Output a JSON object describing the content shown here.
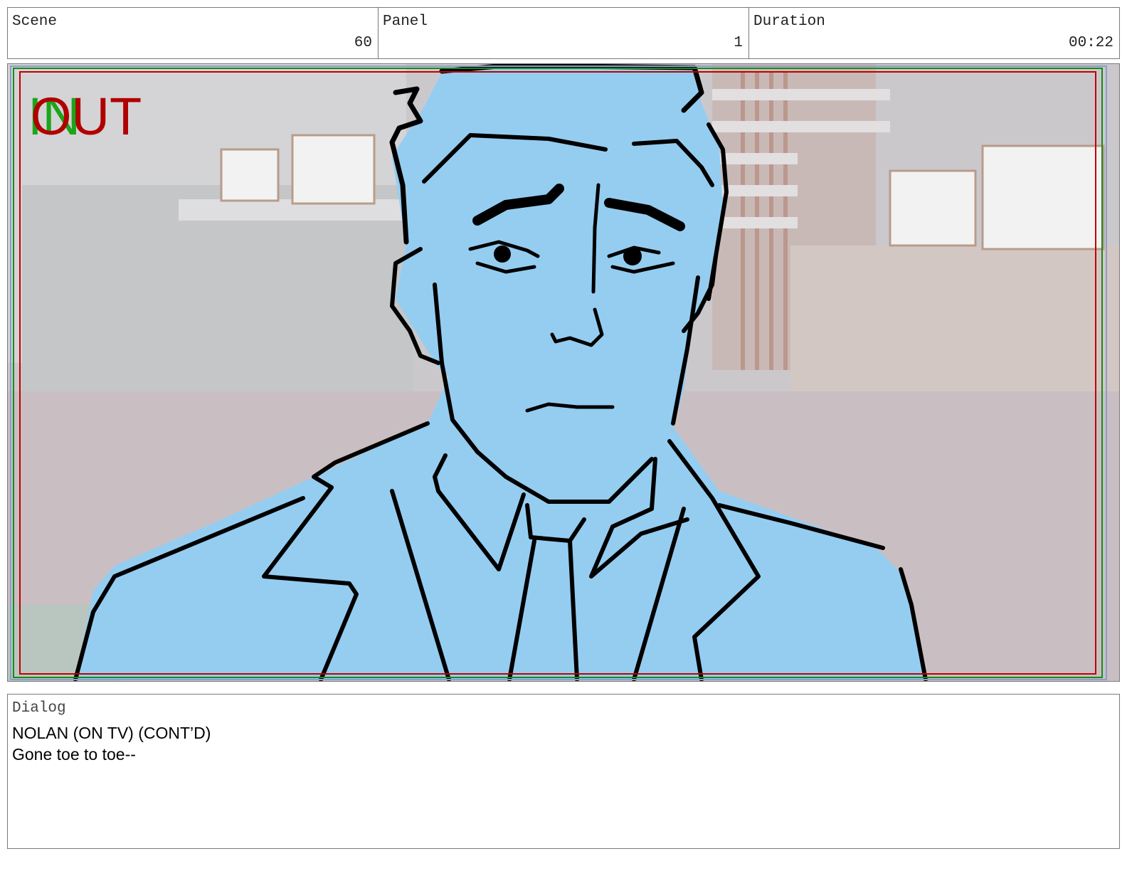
{
  "header": {
    "scene": {
      "label": "Scene",
      "value": "60"
    },
    "panel": {
      "label": "Panel",
      "value": "1"
    },
    "duration": {
      "label": "Duration",
      "value": "00:22"
    }
  },
  "frame": {
    "in_marker": "IN",
    "out_marker": "OUT",
    "character_fill": "#95cdf1",
    "line_color": "#000000",
    "safe_frame_color": "#c00000",
    "action_frame_color": "#1a8a1a"
  },
  "dialog": {
    "label": "Dialog",
    "speaker": "NOLAN (ON TV) (CONT’D)",
    "line": "Gone toe to toe--"
  }
}
